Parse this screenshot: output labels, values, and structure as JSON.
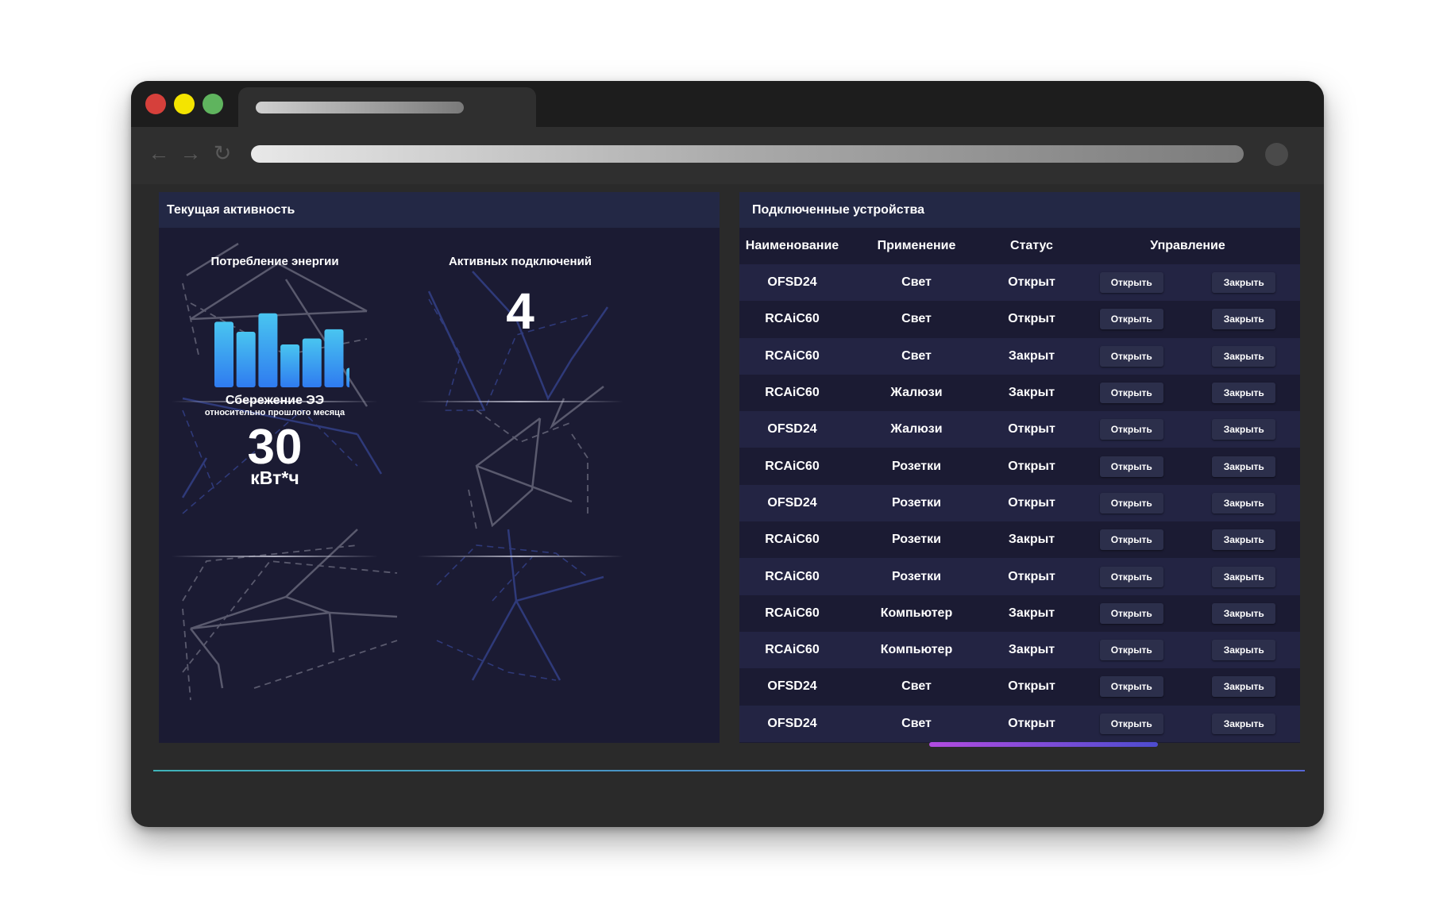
{
  "window": {
    "traffic_lights": [
      "#d6403b",
      "#f4e400",
      "#5fb45e"
    ]
  },
  "activity": {
    "title": "Текущая активность",
    "energy": {
      "title": "Потребление энергии",
      "bar_values": [
        78,
        66,
        88,
        51,
        58,
        69,
        23
      ],
      "bar_color_top": "#49c5f0",
      "bar_color_bottom": "#2f7bf0"
    },
    "connections": {
      "title": "Активных подключений",
      "value": "4"
    },
    "savings": {
      "title": "Сбережение ЭЭ",
      "subtitle": "относительно прошлого месяца",
      "value": "30",
      "unit": "кВт*ч"
    }
  },
  "devices": {
    "title": "Подключенные устройства",
    "columns": [
      "Наименование",
      "Применение",
      "Статус",
      "Управление"
    ],
    "open_label": "Открыть",
    "close_label": "Закрыть",
    "rows": [
      {
        "name": "OFSD24",
        "use": "Свет",
        "status": "Открыт"
      },
      {
        "name": "RCAiC60",
        "use": "Свет",
        "status": "Открыт"
      },
      {
        "name": "RCAiC60",
        "use": "Свет",
        "status": "Закрыт"
      },
      {
        "name": "RCAiC60",
        "use": "Жалюзи",
        "status": "Закрыт"
      },
      {
        "name": "OFSD24",
        "use": "Жалюзи",
        "status": "Открыт"
      },
      {
        "name": "RCAiC60",
        "use": "Розетки",
        "status": "Открыт"
      },
      {
        "name": "OFSD24",
        "use": "Розетки",
        "status": "Открыт"
      },
      {
        "name": "RCAiC60",
        "use": "Розетки",
        "status": "Закрыт"
      },
      {
        "name": "RCAiC60",
        "use": "Розетки",
        "status": "Открыт"
      },
      {
        "name": "RCAiC60",
        "use": "Компьютер",
        "status": "Закрыт"
      },
      {
        "name": "RCAiC60",
        "use": "Компьютер",
        "status": "Закрыт"
      },
      {
        "name": "OFSD24",
        "use": "Свет",
        "status": "Открыт"
      },
      {
        "name": "OFSD24",
        "use": "Свет",
        "status": "Открыт"
      }
    ]
  }
}
